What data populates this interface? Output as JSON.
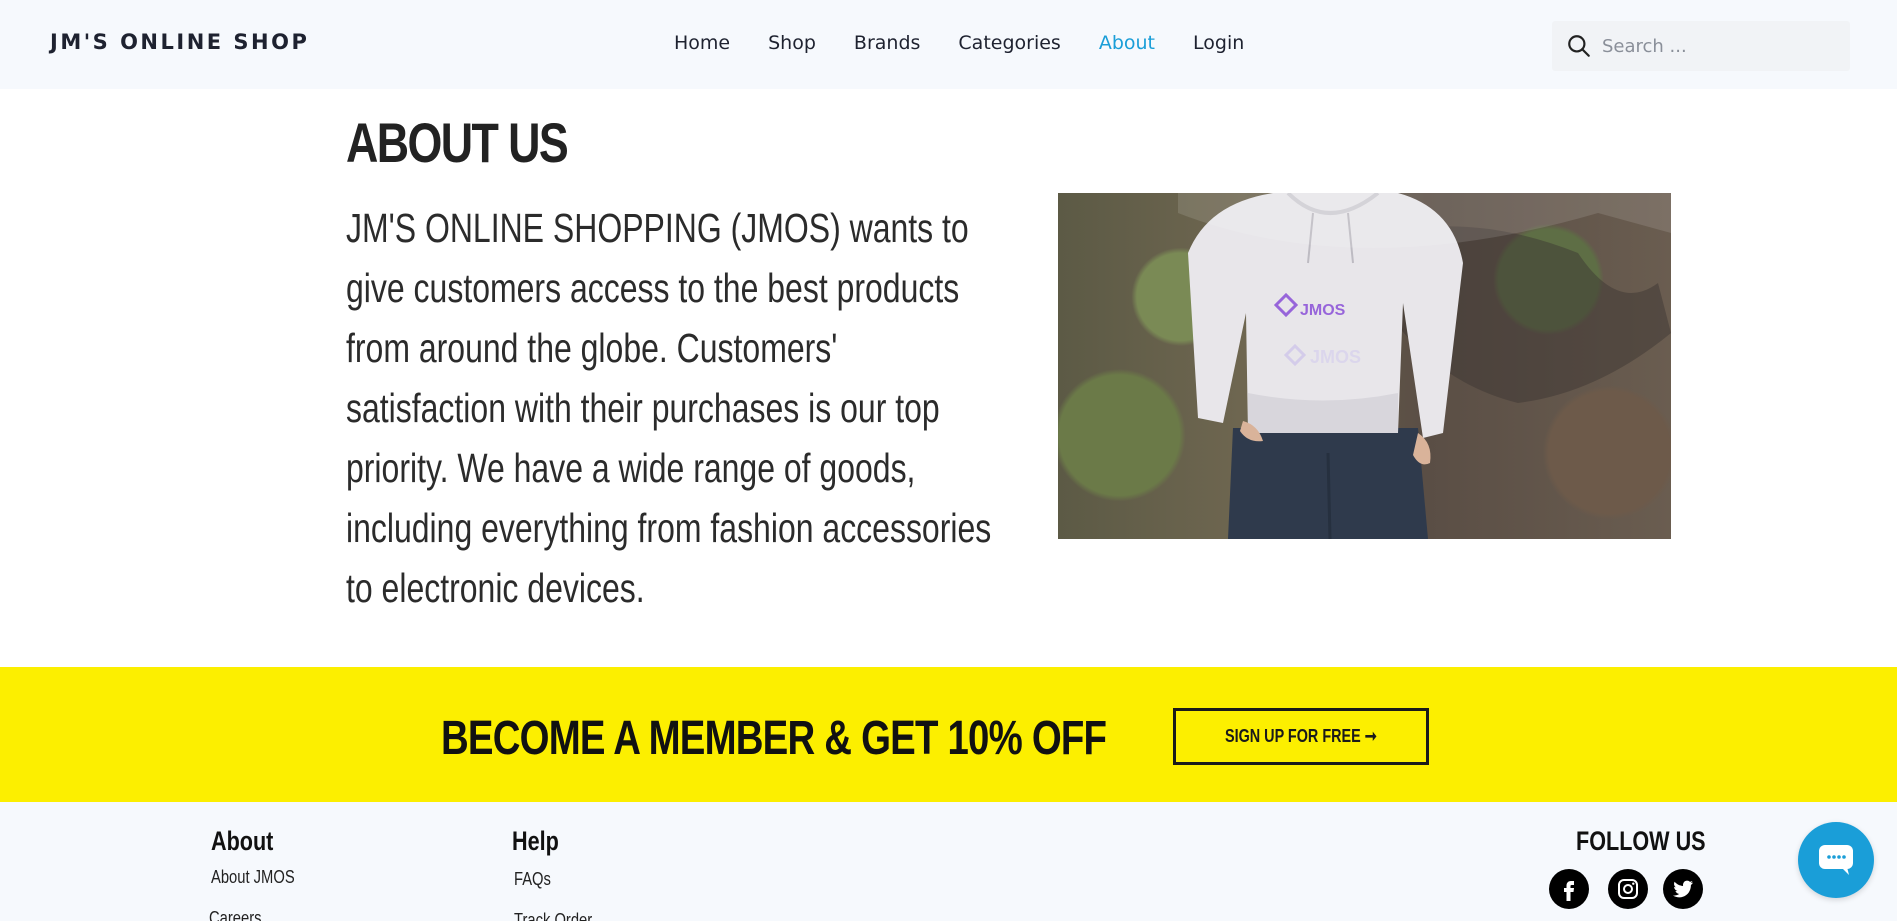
{
  "header": {
    "brand": "JM'S ONLINE SHOP",
    "nav": [
      {
        "label": "Home"
      },
      {
        "label": "Shop"
      },
      {
        "label": "Brands"
      },
      {
        "label": "Categories"
      },
      {
        "label": "About",
        "active": true
      },
      {
        "label": "Login"
      }
    ],
    "search_placeholder": "Search ..."
  },
  "about": {
    "title": "ABOUT US",
    "body": "JM'S ONLINE SHOPPING (JMOS) wants to give customers access to the best products from around the globe. Customers' satisfaction with their purchases is our top priority. We have a wide range of goods, including everything from fashion accessories to electronic devices.",
    "image_logo_text": "JMOS"
  },
  "member": {
    "headline": "BECOME A MEMBER & GET 10% OFF",
    "button_label": "SIGN UP FOR FREE ➞"
  },
  "footer": {
    "about_title": "About",
    "about_links": [
      "About JMOS",
      "Careers"
    ],
    "help_title": "Help",
    "help_links": [
      "FAQs",
      "Track Order"
    ],
    "follow_title": "FOLLOW US",
    "social_icons": [
      "facebook-icon",
      "instagram-icon",
      "twitter-icon"
    ]
  },
  "colors": {
    "header_bg": "#f6f9fd",
    "accent_blue": "#1a9ed8",
    "band_yellow": "#fcef00"
  }
}
